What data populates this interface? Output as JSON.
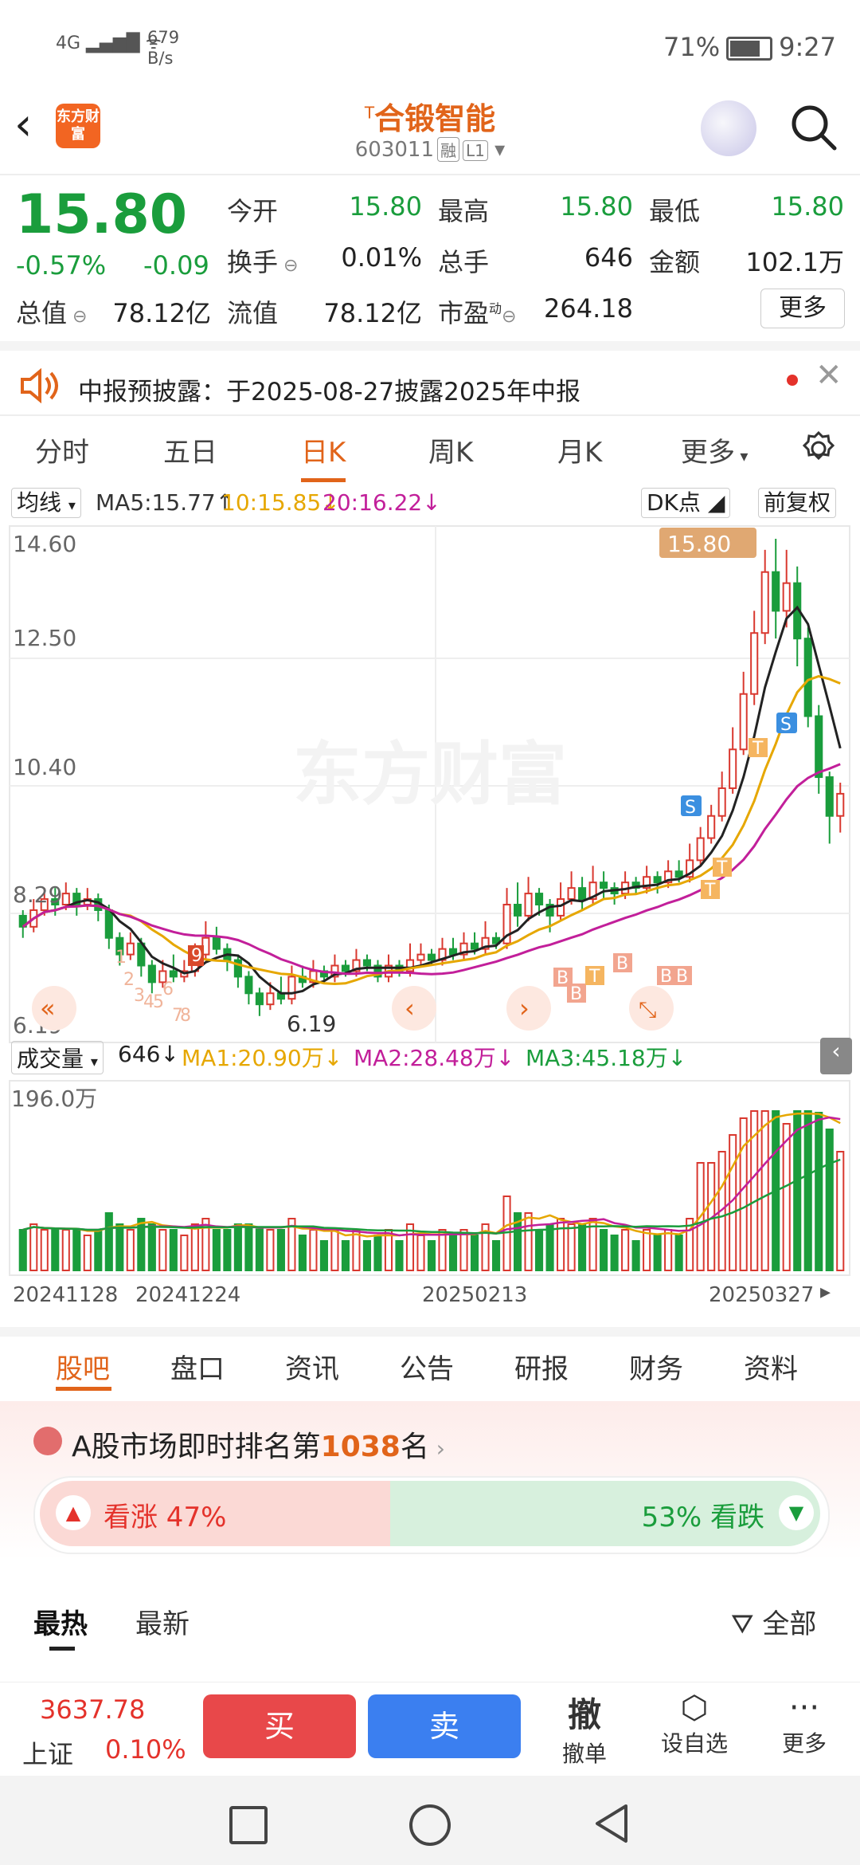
{
  "status": {
    "network": "4G",
    "speed_value": "679",
    "speed_unit": "B/s",
    "battery": "71%",
    "time": "9:27"
  },
  "header": {
    "logo_text": "东方财富",
    "name": "合锻智能",
    "name_prefix": "T",
    "code": "603011",
    "tags": [
      "融",
      "L1"
    ]
  },
  "quote": {
    "price": "15.80",
    "change_pct": "-0.57%",
    "change_amt": "-0.09",
    "fields": [
      {
        "label": "今开",
        "value": "15.80",
        "green": true
      },
      {
        "label": "最高",
        "value": "15.80",
        "green": true
      },
      {
        "label": "最低",
        "value": "15.80",
        "green": true
      },
      {
        "label": "换手",
        "value": "0.01%",
        "green": false
      },
      {
        "label": "总手",
        "value": "646",
        "green": false
      },
      {
        "label": "金额",
        "value": "102.1万",
        "green": false
      },
      {
        "label": "总值",
        "value": "78.12亿",
        "green": false
      },
      {
        "label": "流值",
        "value": "78.12亿",
        "green": false
      },
      {
        "label": "市盈",
        "value": "264.18",
        "green": false
      }
    ],
    "pe_superscript": "动",
    "more_label": "更多"
  },
  "notice": {
    "text": "中报预披露：于2025-08-27披露2025年中报"
  },
  "ktabs": [
    "分时",
    "五日",
    "日K",
    "周K",
    "月K",
    "更多"
  ],
  "ktab_active": 2,
  "indicators": {
    "selector": "均线",
    "ma5": "MA5:15.77↑",
    "ma10": "10:15.85↓",
    "ma20": "20:16.22↓",
    "dk": "DK点",
    "fq": "前复权"
  },
  "chart_data": {
    "type": "candlestick",
    "price_axis": [
      "14.60",
      "12.50",
      "10.40",
      "8.29",
      "6.19"
    ],
    "ylim": [
      6.19,
      14.6
    ],
    "price_tag": "15.80",
    "low_label": "6.19",
    "candles": [
      [
        8.0,
        7.8,
        8.1,
        7.6
      ],
      [
        7.8,
        8.1,
        8.3,
        7.7
      ],
      [
        8.1,
        8.3,
        8.5,
        8.0
      ],
      [
        8.3,
        8.2,
        8.5,
        8.0
      ],
      [
        8.2,
        8.4,
        8.6,
        8.1
      ],
      [
        8.4,
        8.2,
        8.5,
        8.0
      ],
      [
        8.2,
        8.3,
        8.5,
        8.1
      ],
      [
        8.3,
        8.1,
        8.4,
        7.9
      ],
      [
        8.1,
        7.6,
        8.2,
        7.4
      ],
      [
        7.6,
        7.3,
        7.7,
        7.1
      ],
      [
        7.3,
        7.5,
        7.7,
        7.2
      ],
      [
        7.5,
        7.1,
        7.6,
        6.9
      ],
      [
        7.1,
        6.8,
        7.2,
        6.6
      ],
      [
        6.8,
        7.0,
        7.2,
        6.7
      ],
      [
        7.0,
        6.9,
        7.3,
        6.8
      ],
      [
        6.9,
        7.0,
        7.2,
        6.8
      ],
      [
        7.0,
        7.3,
        7.5,
        6.9
      ],
      [
        7.3,
        7.6,
        7.9,
        7.2
      ],
      [
        7.6,
        7.4,
        7.8,
        7.3
      ],
      [
        7.4,
        7.2,
        7.5,
        7.0
      ],
      [
        7.2,
        6.9,
        7.3,
        6.7
      ],
      [
        6.9,
        6.6,
        7.0,
        6.4
      ],
      [
        6.6,
        6.4,
        6.7,
        6.19
      ],
      [
        6.4,
        6.6,
        6.8,
        6.3
      ],
      [
        6.6,
        6.5,
        6.9,
        6.4
      ],
      [
        6.5,
        6.9,
        7.1,
        6.4
      ],
      [
        6.9,
        6.8,
        7.1,
        6.7
      ],
      [
        6.8,
        7.0,
        7.2,
        6.7
      ],
      [
        7.0,
        6.9,
        7.1,
        6.8
      ],
      [
        6.9,
        7.1,
        7.3,
        6.8
      ],
      [
        7.1,
        7.0,
        7.2,
        6.9
      ],
      [
        7.0,
        7.2,
        7.4,
        6.9
      ],
      [
        7.2,
        7.1,
        7.3,
        7.0
      ],
      [
        7.1,
        6.9,
        7.2,
        6.8
      ],
      [
        6.9,
        7.1,
        7.3,
        6.8
      ],
      [
        7.1,
        7.0,
        7.2,
        6.9
      ],
      [
        7.0,
        7.2,
        7.5,
        6.9
      ],
      [
        7.2,
        7.3,
        7.5,
        7.1
      ],
      [
        7.3,
        7.2,
        7.4,
        7.1
      ],
      [
        7.2,
        7.4,
        7.6,
        7.1
      ],
      [
        7.4,
        7.3,
        7.6,
        7.2
      ],
      [
        7.3,
        7.5,
        7.7,
        7.2
      ],
      [
        7.5,
        7.4,
        7.7,
        7.3
      ],
      [
        7.4,
        7.6,
        7.9,
        7.3
      ],
      [
        7.6,
        7.5,
        7.7,
        7.4
      ],
      [
        7.5,
        8.2,
        8.5,
        7.4
      ],
      [
        8.2,
        8.0,
        8.6,
        7.8
      ],
      [
        8.0,
        8.4,
        8.7,
        7.9
      ],
      [
        8.4,
        8.2,
        8.5,
        8.0
      ],
      [
        8.2,
        8.0,
        8.3,
        7.7
      ],
      [
        8.0,
        8.3,
        8.6,
        7.9
      ],
      [
        8.3,
        8.5,
        8.8,
        8.2
      ],
      [
        8.5,
        8.3,
        8.7,
        8.1
      ],
      [
        8.3,
        8.6,
        8.9,
        8.2
      ],
      [
        8.6,
        8.5,
        8.8,
        8.3
      ],
      [
        8.5,
        8.4,
        8.6,
        8.2
      ],
      [
        8.4,
        8.6,
        8.8,
        8.3
      ],
      [
        8.6,
        8.5,
        8.7,
        8.4
      ],
      [
        8.5,
        8.7,
        8.9,
        8.4
      ],
      [
        8.7,
        8.6,
        8.8,
        8.4
      ],
      [
        8.6,
        8.8,
        9.0,
        8.5
      ],
      [
        8.8,
        8.7,
        9.0,
        8.6
      ],
      [
        8.7,
        9.0,
        9.3,
        8.6
      ],
      [
        9.0,
        9.4,
        9.6,
        8.9
      ],
      [
        9.4,
        9.8,
        10.0,
        9.3
      ],
      [
        9.8,
        10.3,
        10.6,
        9.7
      ],
      [
        10.3,
        11.0,
        11.4,
        10.2
      ],
      [
        11.0,
        12.0,
        12.4,
        10.9
      ],
      [
        12.0,
        13.1,
        13.5,
        11.8
      ],
      [
        13.1,
        14.2,
        14.6,
        12.9
      ],
      [
        14.2,
        13.5,
        14.8,
        13.0
      ],
      [
        13.5,
        14.0,
        14.6,
        13.2
      ],
      [
        14.0,
        13.0,
        14.3,
        12.5
      ],
      [
        13.0,
        11.6,
        13.2,
        11.4
      ],
      [
        11.6,
        10.5,
        11.8,
        10.2
      ],
      [
        10.5,
        9.8,
        10.6,
        9.3
      ],
      [
        9.8,
        10.2,
        10.4,
        9.5
      ]
    ],
    "ma_lines": [
      "MA5",
      "MA10",
      "MA20"
    ],
    "signal_labels": [
      "1",
      "2",
      "3",
      "4",
      "5",
      "6",
      "7",
      "8",
      "9",
      "S",
      "B",
      "T"
    ]
  },
  "volume": {
    "label": "成交量",
    "current": "646↓",
    "ma1": "MA1:20.90万↓",
    "ma2": "MA2:28.48万↓",
    "ma3": "MA3:45.18万↓",
    "axis_max": "196.0万"
  },
  "dates": [
    "20241128",
    "20241224",
    "20250213",
    "20250327"
  ],
  "btabs": [
    "股吧",
    "盘口",
    "资讯",
    "公告",
    "研报",
    "财务",
    "资料"
  ],
  "btab_active": 0,
  "rank": {
    "prefix": "A股市场即时排名第",
    "num": "1038",
    "suffix": "名"
  },
  "sentiment": {
    "up": "看涨 47%",
    "down": "53% 看跌"
  },
  "feedtabs": [
    "最热",
    "最新"
  ],
  "filter": "全部",
  "index": {
    "value": "3637.78",
    "name": "上证",
    "pct": "0.10%"
  },
  "trade": {
    "buy": "买",
    "sell": "卖",
    "cancel": "撤单",
    "cancel_icon": "撤",
    "watch": "设自选",
    "more": "更多"
  }
}
